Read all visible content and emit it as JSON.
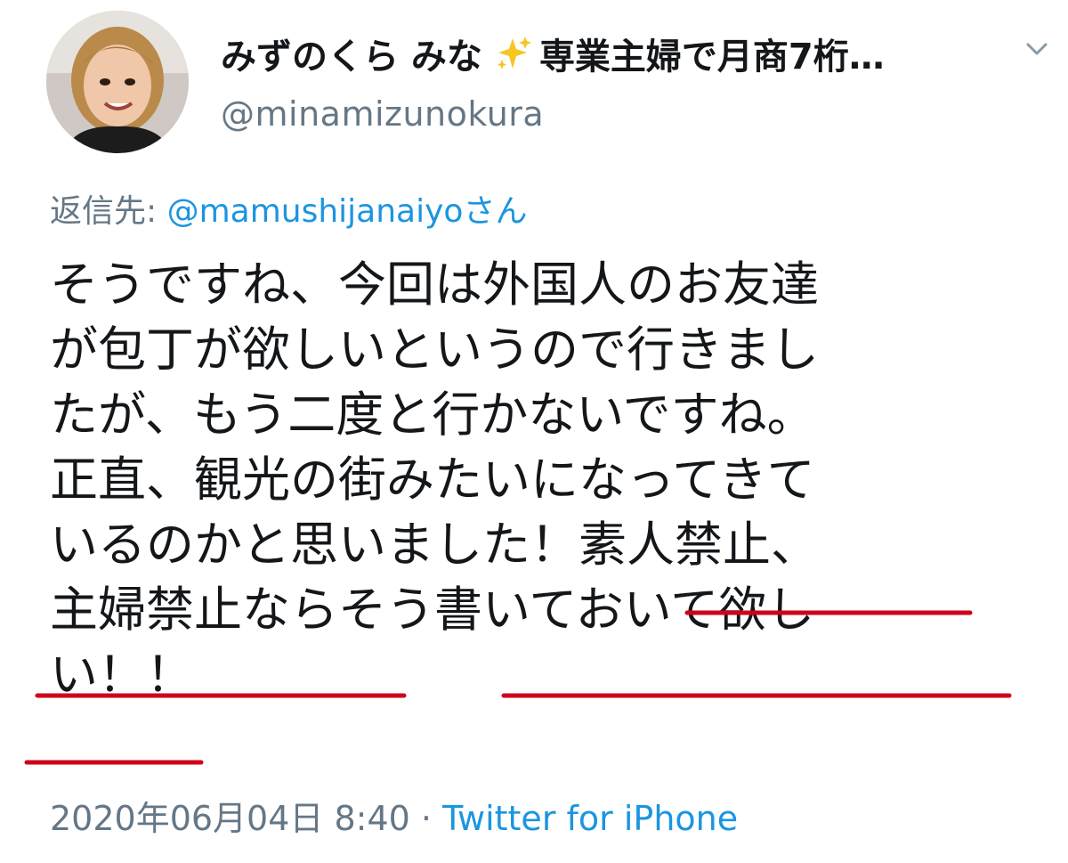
{
  "author": {
    "display_name": "みずのくら みな",
    "sparkle": "✨",
    "bio_snippet": "専業主婦で月商7桁…",
    "handle": "@minamizunokura",
    "avatar_icon": "avatar-photo-icon"
  },
  "reply": {
    "prefix": "返信先: ",
    "mention": "@mamushijanaiyoさん"
  },
  "tweet": {
    "lines": [
      "そうですね、今回は外国人のお友達",
      "が包丁が欲しいというので行きまし",
      "たが、もう二度と行かないですね。",
      "正直、観光の街みたいになってきて",
      "いるのかと思いました！素人禁止、",
      "主婦禁止ならそう書いておいて欲し",
      "い！！"
    ],
    "underline_color": "#d0021b"
  },
  "meta": {
    "timestamp": "2020年06月04日 8:40",
    "separator": " · ",
    "source": "Twitter for iPhone"
  },
  "colors": {
    "text": "#14171a",
    "secondary": "#657786",
    "link": "#1b95e0"
  }
}
